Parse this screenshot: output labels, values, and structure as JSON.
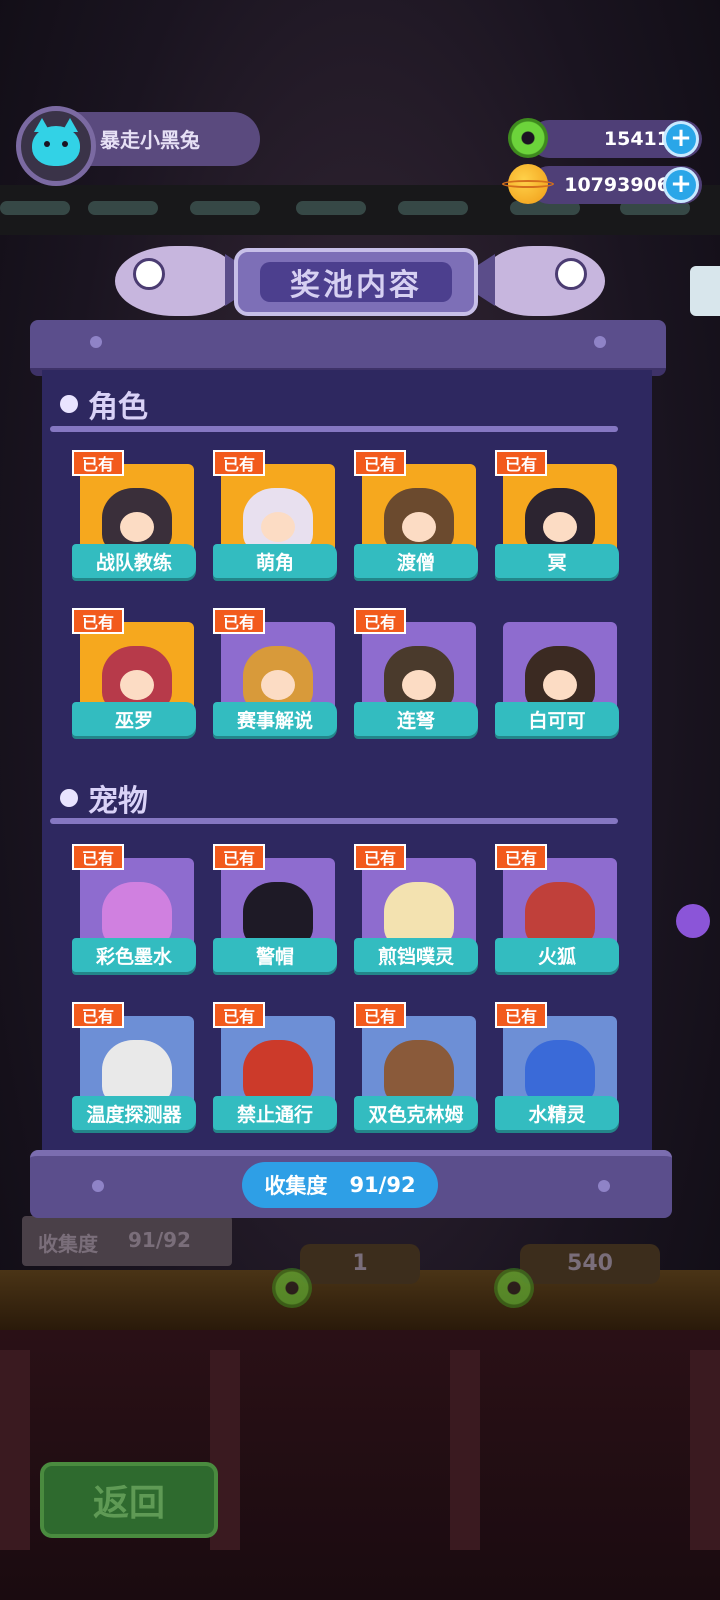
{
  "profile": {
    "username": "暴走小黑兔",
    "avatar_icon": "cyan-cat-avatar-icon"
  },
  "currency": [
    {
      "icon": "green-donut-coin-icon",
      "value": "15411",
      "add_label": "+"
    },
    {
      "icon": "orange-planet-coin-icon",
      "value": "10793906",
      "add_label": "+"
    }
  ],
  "panel": {
    "title": "奖池内容",
    "sections": [
      {
        "title": "角色",
        "items": [
          {
            "name": "战队教练",
            "badge": "已有",
            "bg": "gold"
          },
          {
            "name": "萌角",
            "badge": "已有",
            "bg": "gold"
          },
          {
            "name": "渡僧",
            "badge": "已有",
            "bg": "gold"
          },
          {
            "name": "冥",
            "badge": "已有",
            "bg": "gold"
          },
          {
            "name": "巫罗",
            "badge": "已有",
            "bg": "gold"
          },
          {
            "name": "赛事解说",
            "badge": "已有",
            "bg": "purple"
          },
          {
            "name": "连弩",
            "badge": "已有",
            "bg": "purple"
          },
          {
            "name": "白可可",
            "badge": "",
            "bg": "purple"
          }
        ]
      },
      {
        "title": "宠物",
        "items": [
          {
            "name": "彩色墨水",
            "badge": "已有",
            "bg": "purple"
          },
          {
            "name": "警帽",
            "badge": "已有",
            "bg": "purple"
          },
          {
            "name": "煎铛噗灵",
            "badge": "已有",
            "bg": "purple"
          },
          {
            "name": "火狐",
            "badge": "已有",
            "bg": "purple"
          },
          {
            "name": "温度探测器",
            "badge": "已有",
            "bg": "blue"
          },
          {
            "name": "禁止通行",
            "badge": "已有",
            "bg": "blue"
          },
          {
            "name": "双色克林姆",
            "badge": "已有",
            "bg": "blue"
          },
          {
            "name": "水精灵",
            "badge": "已有",
            "bg": "blue"
          }
        ]
      }
    ],
    "collection_label": "收集度",
    "collection_value": "91/92"
  },
  "background": {
    "collection_label": "收集度",
    "collection_value": "91/92",
    "cost_single": "1",
    "cost_multi": "540",
    "back_button": "返回"
  },
  "colors": {
    "owned_badge": "#f25a1c",
    "name_label": "#33bcc0",
    "panel": "#2e2860"
  }
}
